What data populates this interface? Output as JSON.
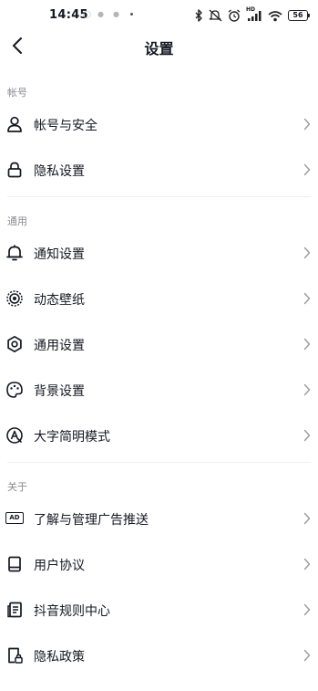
{
  "status_bar": {
    "time": "14:45",
    "notification_icons": [
      "weibo-icon",
      "chat-icon",
      "chat-icon"
    ],
    "right_icons": [
      "bluetooth-icon",
      "mute-icon",
      "alarm-icon",
      "signal-icon",
      "wifi-icon"
    ],
    "signal_label": "HD",
    "battery": "56"
  },
  "header": {
    "title": "设置"
  },
  "sections": [
    {
      "title": "帐号",
      "items": [
        {
          "label": "帐号与安全",
          "icon": "user-icon"
        },
        {
          "label": "隐私设置",
          "icon": "lock-icon"
        }
      ]
    },
    {
      "title": "通用",
      "items": [
        {
          "label": "通知设置",
          "icon": "bell-icon"
        },
        {
          "label": "动态壁纸",
          "icon": "live-wallpaper-icon"
        },
        {
          "label": "通用设置",
          "icon": "gear-icon"
        },
        {
          "label": "背景设置",
          "icon": "palette-icon"
        },
        {
          "label": "大字简明模式",
          "icon": "large-font-icon"
        }
      ]
    },
    {
      "title": "关于",
      "items": [
        {
          "label": "了解与管理广告推送",
          "icon": "ad-icon",
          "icon_text": "AD"
        },
        {
          "label": "用户协议",
          "icon": "agreement-book-icon"
        },
        {
          "label": "抖音规则中心",
          "icon": "rules-document-icon"
        },
        {
          "label": "隐私政策",
          "icon": "privacy-policy-icon"
        }
      ]
    }
  ]
}
